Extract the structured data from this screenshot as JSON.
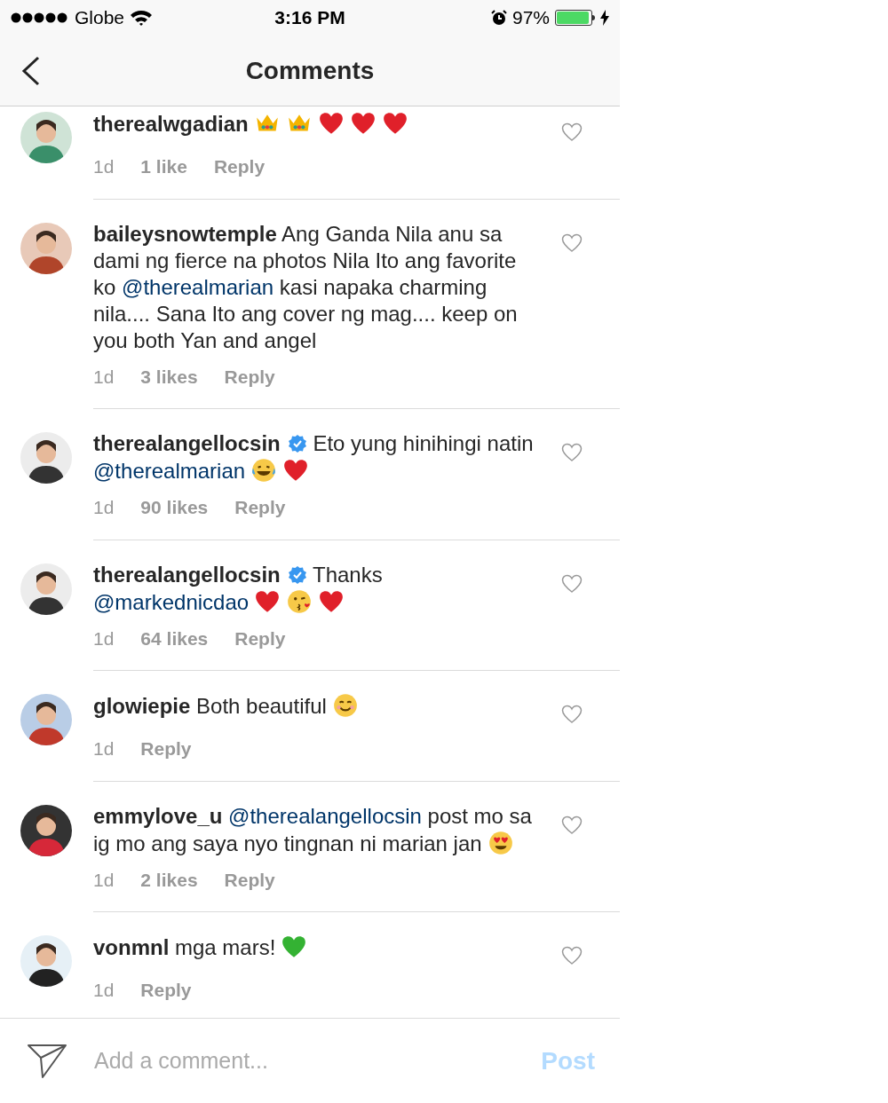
{
  "status_bar": {
    "carrier": "Globe",
    "time": "3:16 PM",
    "battery": "97%"
  },
  "nav": {
    "title": "Comments"
  },
  "comments": [
    {
      "username": "therealwgadian",
      "verified": false,
      "body": [
        {
          "kind": "crown"
        },
        {
          "kind": "crown"
        },
        {
          "kind": "red_heart"
        },
        {
          "kind": "red_heart"
        },
        {
          "kind": "red_heart"
        }
      ],
      "time": "1d",
      "likes": "1 like",
      "reply": "Reply"
    },
    {
      "username": "baileysnowtemple",
      "verified": false,
      "body": [
        {
          "kind": "text",
          "text": "Ang Ganda Nila anu sa dami ng fierce na photos Nila Ito ang favorite ko"
        },
        {
          "kind": "mention",
          "text": "@therealmarian"
        },
        {
          "kind": "text",
          "text": "kasi napaka charming nila.... Sana Ito ang cover ng mag.... keep on you both Yan and angel"
        }
      ],
      "time": "1d",
      "likes": "3 likes",
      "reply": "Reply"
    },
    {
      "username": "therealangellocsin",
      "verified": true,
      "body": [
        {
          "kind": "text",
          "text": "Eto yung hinihingi natin"
        },
        {
          "kind": "mention",
          "text": "@therealmarian"
        },
        {
          "kind": "tears_of_joy"
        },
        {
          "kind": "red_heart"
        }
      ],
      "time": "1d",
      "likes": "90 likes",
      "reply": "Reply"
    },
    {
      "username": "therealangellocsin",
      "verified": true,
      "body": [
        {
          "kind": "text",
          "text": "Thanks"
        },
        {
          "kind": "mention",
          "text": "@markednicdao"
        },
        {
          "kind": "red_heart"
        },
        {
          "kind": "kiss"
        },
        {
          "kind": "red_heart"
        }
      ],
      "time": "1d",
      "likes": "64 likes",
      "reply": "Reply"
    },
    {
      "username": "glowiepie",
      "verified": false,
      "body": [
        {
          "kind": "text",
          "text": "Both beautiful"
        },
        {
          "kind": "smile"
        }
      ],
      "time": "1d",
      "reply": "Reply"
    },
    {
      "username": "emmylove_u",
      "verified": false,
      "body": [
        {
          "kind": "mention",
          "text": "@therealangellocsin"
        },
        {
          "kind": "text",
          "text": "post mo sa ig mo ang saya nyo tingnan ni marian jan"
        },
        {
          "kind": "heart_eyes"
        }
      ],
      "time": "1d",
      "likes": "2 likes",
      "reply": "Reply"
    },
    {
      "username": "vonmnl",
      "verified": false,
      "body": [
        {
          "kind": "text",
          "text": "mga mars!"
        },
        {
          "kind": "green_heart"
        }
      ],
      "time": "1d",
      "reply": "Reply"
    }
  ],
  "composer": {
    "placeholder": "Add a comment...",
    "post": "Post",
    "post_disabled": true
  }
}
